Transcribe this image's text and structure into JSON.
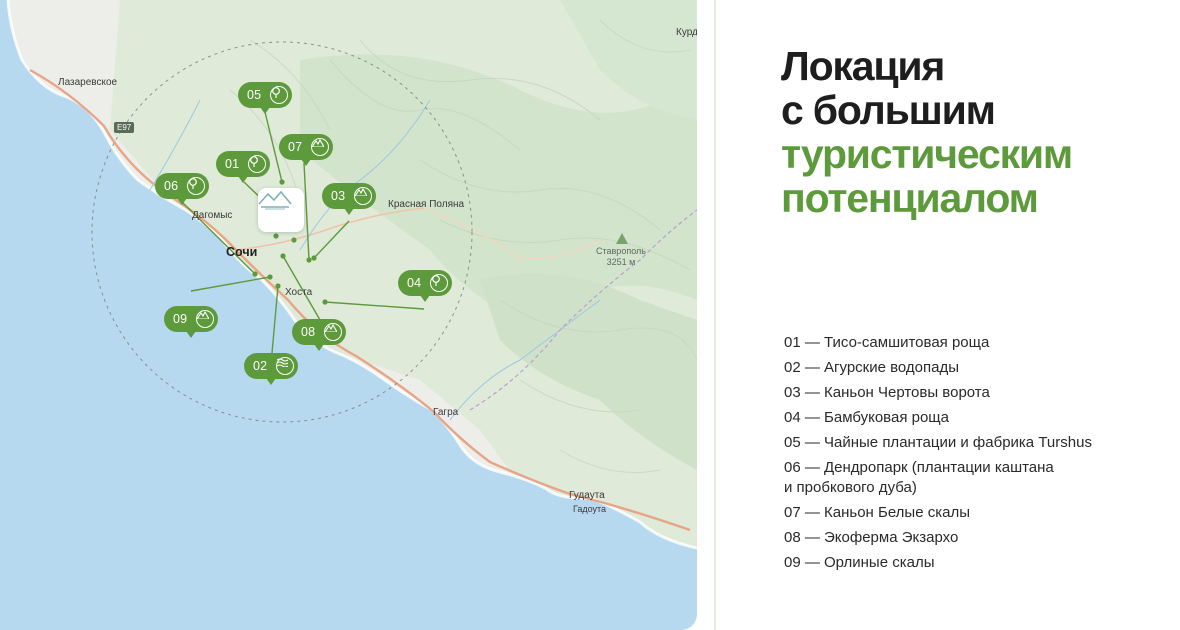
{
  "headline": {
    "line1": "Локация",
    "line2": "с большим",
    "line3": "туристическим",
    "line4": "потенциалом",
    "dark_color": "#1e1e1e",
    "accent_color": "#5d9a3b"
  },
  "legend": [
    "01 — Тисо-самшитовая роща",
    "02 — Агурские водопады",
    "03 — Каньон Чертовы ворота",
    "04 — Бамбуковая роща",
    "05 — Чайные плантации и фабрика Turshus",
    "06 — Дендропарк (плантации каштана",
    "и пробкового дуба)",
    "07 — Каньон Белые скалы",
    "08 — Экоферма Экзархо",
    "09 — Орлиные скалы"
  ],
  "map": {
    "places": {
      "lazarevskoe": "Лазаревское",
      "dagomys": "Дагомыс",
      "sochi": "Сочи",
      "khosta": "Хоста",
      "krasnaya_polyana": "Красная Поляна",
      "gagra": "Гагра",
      "gudauta_ru": "Гудаута",
      "gudauta_ab": "Гадоута",
      "kurdzhipsk": "Курд"
    },
    "peak": {
      "name": "Ставрополь",
      "height": "3251 м"
    },
    "road_badge": "E97",
    "markers": [
      {
        "num": "01",
        "icon": "tree-icon"
      },
      {
        "num": "02",
        "icon": "waves-icon"
      },
      {
        "num": "03",
        "icon": "mountain-icon"
      },
      {
        "num": "04",
        "icon": "tree-icon"
      },
      {
        "num": "05",
        "icon": "tree-icon"
      },
      {
        "num": "06",
        "icon": "tree-icon"
      },
      {
        "num": "07",
        "icon": "mountain-icon"
      },
      {
        "num": "08",
        "icon": "mountain-icon"
      },
      {
        "num": "09",
        "icon": "mountain-icon"
      }
    ],
    "colors": {
      "sea": "#b6d9ef",
      "land": "#edeeea",
      "forest": "#d4e6cf",
      "road": "#e8a585",
      "marker": "#5d9a3b"
    }
  }
}
